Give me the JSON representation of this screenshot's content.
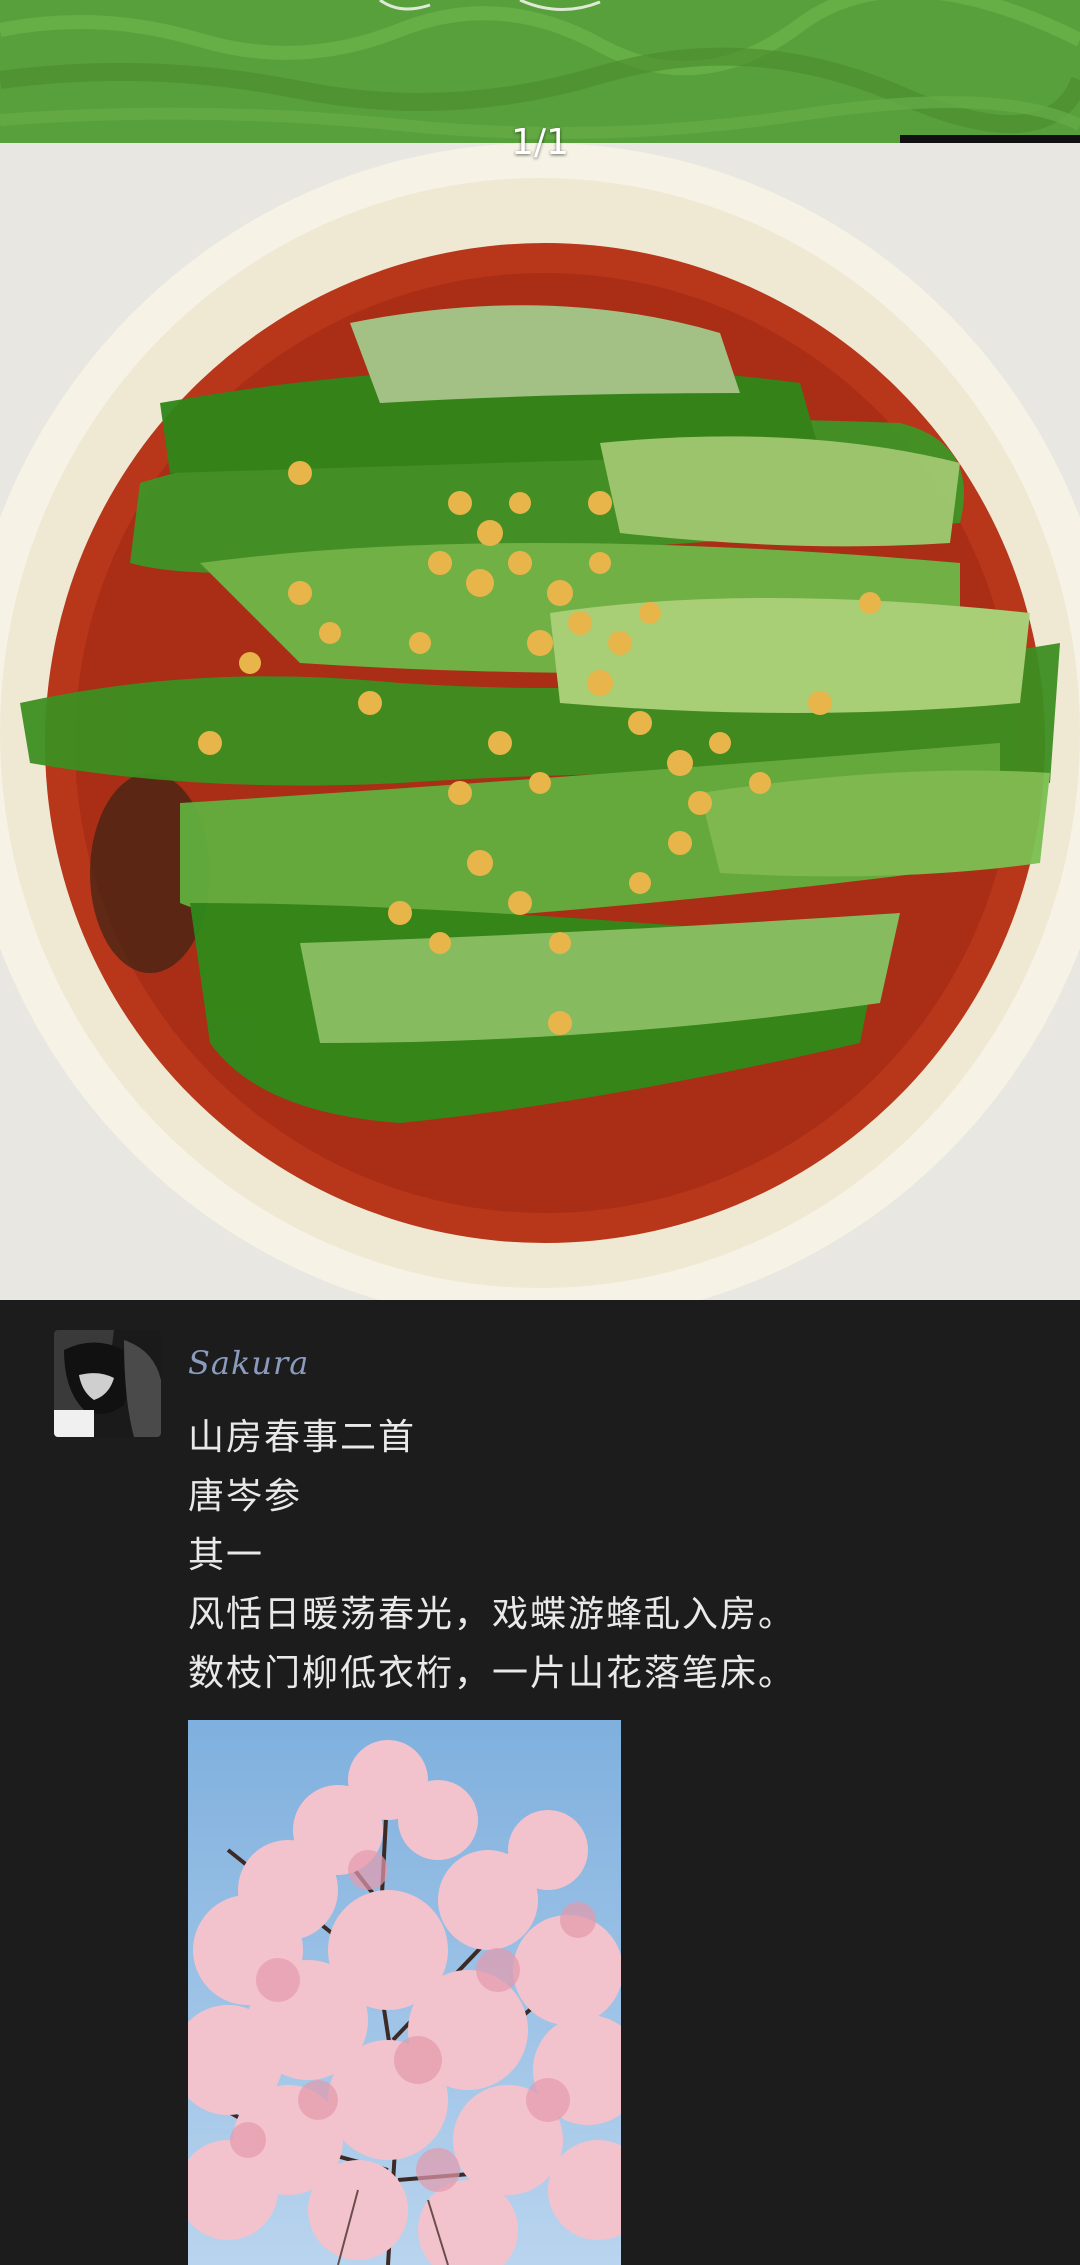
{
  "viewer": {
    "page_counter": "1/1"
  },
  "post": {
    "username": "Sakura",
    "poem_lines": [
      "山房春事二首",
      "唐岑参",
      "其一",
      "风恬日暖荡春光，戏蝶游蜂乱入房。",
      "数枝门柳低衣桁，一片山花落笔床。"
    ]
  },
  "colors": {
    "background": "#1c1c1c",
    "username": "#8b9bbd",
    "poem_text": "#e9e9e9"
  },
  "icons": [
    "avatar",
    "lettuce-dish-photo",
    "cherry-blossom-photo"
  ]
}
